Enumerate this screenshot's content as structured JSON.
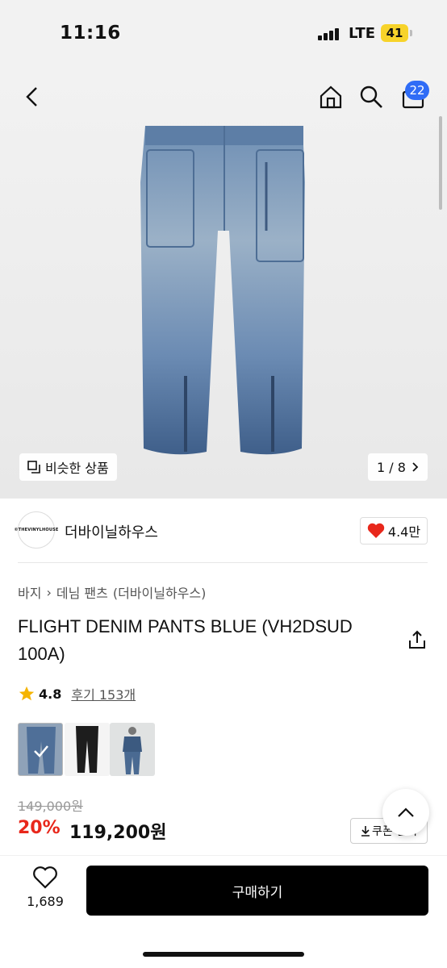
{
  "status_bar": {
    "time": "11:16",
    "network": "LTE",
    "battery": "41"
  },
  "header": {
    "cart_count": "22"
  },
  "gallery": {
    "similar_label": "비슷한 상품",
    "pager": "1 / 8"
  },
  "brand": {
    "logo_text": "©THEVINYLHOUSE",
    "name": "더바이닐하우스",
    "likes": "4.4만"
  },
  "breadcrumb": [
    "바지",
    "데님 팬츠",
    "(더바이닐하우스)"
  ],
  "product": {
    "title": "FLIGHT DENIM PANTS BLUE (VH2DSUD 100A)",
    "rating": "4.8",
    "reviews": "후기 153개",
    "variants": [
      "blue-denim",
      "black-denim",
      "model-shot"
    ],
    "original_price": "149,000원",
    "discount": "20%",
    "price": "119,200원",
    "coupon_label": "쿠폰 받기"
  },
  "bottom_bar": {
    "wish_count": "1,689",
    "buy_label": "구매하기"
  },
  "colors": {
    "accent_red": "#e8271b",
    "badge_blue": "#2f6cf6",
    "star": "#f5b400",
    "denim": "#5c7ea8"
  }
}
